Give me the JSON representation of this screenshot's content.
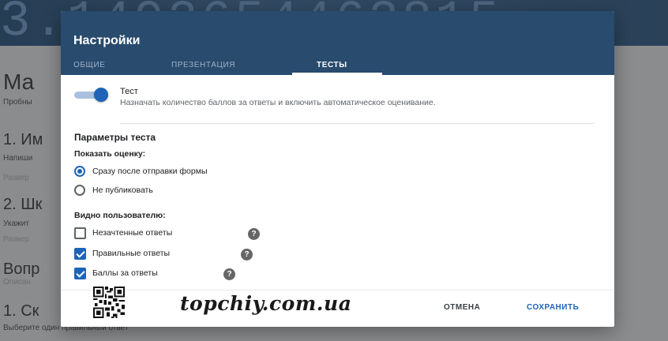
{
  "background": {
    "header_digits": "3.1492654463815",
    "title": "Ма",
    "subtitle": "Пробны",
    "q1": "1. Им",
    "q1_hint": "Напиши",
    "q1_expand": "Развер",
    "q2": "2. Шк",
    "q2_hint": "Укажит",
    "q2_expand": "Развер",
    "section": "Вопр",
    "section_desc": "Описан",
    "q3": "1. Ск",
    "q3_hint": "Выберите один правильный ответ"
  },
  "dialog": {
    "title": "Настройки",
    "tabs": [
      {
        "label": "ОБЩИЕ",
        "active": false
      },
      {
        "label": "ПРЕЗЕНТАЦИЯ",
        "active": false
      },
      {
        "label": "ТЕСТЫ",
        "active": true
      }
    ],
    "quiz_toggle": {
      "label": "Тест",
      "description": "Назначать количество баллов за ответы и включить автоматическое оценивание.",
      "on": true
    },
    "params_title": "Параметры теста",
    "show_score": {
      "label": "Показать оценку:",
      "options": [
        {
          "label": "Сразу после отправки формы",
          "selected": true
        },
        {
          "label": "Не публиковать",
          "selected": false
        }
      ]
    },
    "visible_to_user": {
      "label": "Видно пользователю:",
      "options": [
        {
          "label": "Незачтенные ответы",
          "checked": false,
          "help_icon": "help-icon"
        },
        {
          "label": "Правильные ответы",
          "checked": true,
          "help_icon": "help-icon"
        },
        {
          "label": "Баллы за ответы",
          "checked": true,
          "help_icon": "help-icon"
        }
      ]
    },
    "help_glyph": "?",
    "footer": {
      "watermark": "topchiy.com.ua",
      "cancel_label": "ОТМЕНА",
      "save_label": "СОХРАНИТЬ"
    }
  },
  "colors": {
    "header": "#284b6e",
    "accent": "#1f64b6",
    "toggle_track": "#a9c1de"
  }
}
